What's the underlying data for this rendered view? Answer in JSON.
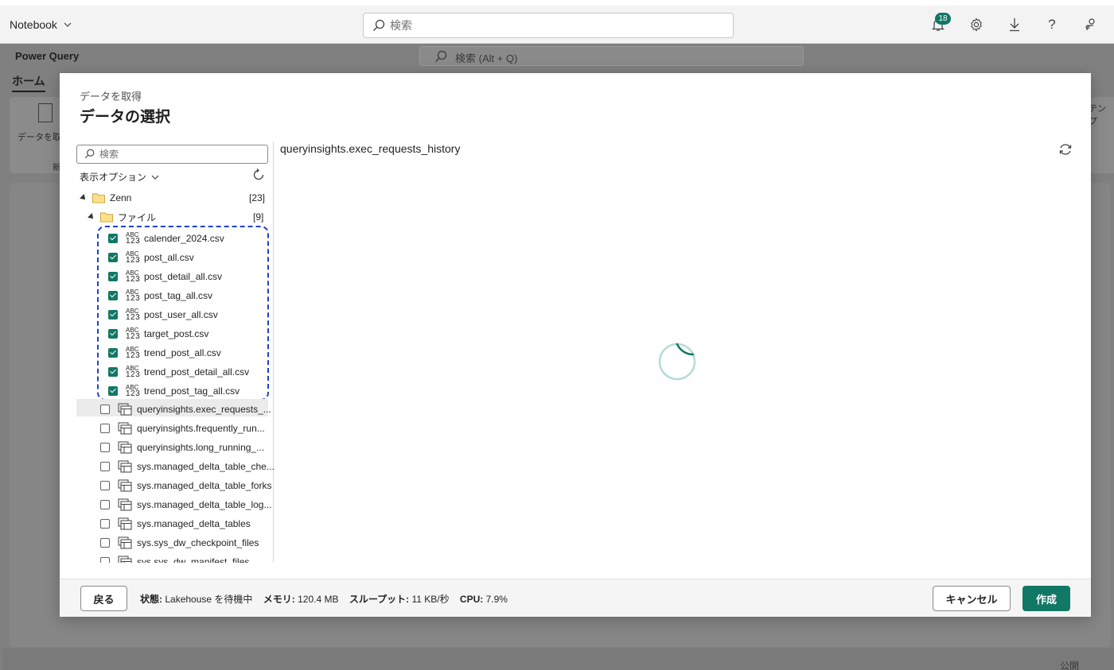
{
  "topbar": {
    "app_title": "Notebook",
    "search_placeholder": "検索",
    "notification_count": "18"
  },
  "background": {
    "pq_title": "Power Query",
    "pq_search_placeholder": "検索 (Alt + Q)",
    "home_tab": "ホーム",
    "ribbon_get_data": "データを取",
    "ribbon_group": "新",
    "right_label": "テンプ",
    "bottom_label": "公開"
  },
  "dialog": {
    "subtitle": "データを取得",
    "title": "データの選択",
    "nav_search_placeholder": "検索",
    "display_options": "表示オプション",
    "tree": {
      "root": {
        "label": "Zenn",
        "count": "[23]"
      },
      "folder": {
        "label": "ファイル",
        "count": "[9]"
      },
      "files": [
        {
          "type_top": "ABC",
          "type_bottom": "123",
          "label": "calender_2024.csv",
          "checked": true
        },
        {
          "type_top": "ABC",
          "type_bottom": "123",
          "label": "post_all.csv",
          "checked": true
        },
        {
          "type_top": "ABC",
          "type_bottom": "123",
          "label": "post_detail_all.csv",
          "checked": true
        },
        {
          "type_top": "ABC",
          "type_bottom": "123",
          "label": "post_tag_all.csv",
          "checked": true
        },
        {
          "type_top": "ABC",
          "type_bottom": "123",
          "label": "post_user_all.csv",
          "checked": true
        },
        {
          "type_top": "ABC",
          "type_bottom": "123",
          "label": "target_post.csv",
          "checked": true
        },
        {
          "type_top": "ABC",
          "type_bottom": "123",
          "label": "trend_post_all.csv",
          "checked": true
        },
        {
          "type_top": "ABC",
          "type_bottom": "123",
          "label": "trend_post_detail_all.csv",
          "checked": true
        },
        {
          "type_top": "ABC",
          "type_bottom": "123",
          "label": "trend_post_tag_all.csv",
          "checked": true
        }
      ],
      "tables": [
        {
          "label": "queryinsights.exec_requests_...",
          "checked": false,
          "selected": true
        },
        {
          "label": "queryinsights.frequently_run...",
          "checked": false
        },
        {
          "label": "queryinsights.long_running_...",
          "checked": false
        },
        {
          "label": "sys.managed_delta_table_che...",
          "checked": false
        },
        {
          "label": "sys.managed_delta_table_forks",
          "checked": false
        },
        {
          "label": "sys.managed_delta_table_log...",
          "checked": false
        },
        {
          "label": "sys.managed_delta_tables",
          "checked": false
        },
        {
          "label": "sys.sys_dw_checkpoint_files",
          "checked": false
        },
        {
          "label": "sys.sys_dw_manifest_files",
          "checked": false
        }
      ]
    },
    "preview_title": "queryinsights.exec_requests_history",
    "footer": {
      "back": "戻る",
      "status_label": "状態:",
      "status_value": "Lakehouse を待機中",
      "memory_label": "メモリ:",
      "memory_value": "120.4 MB",
      "throughput_label": "スループット:",
      "throughput_value": "11 KB/秒",
      "cpu_label": "CPU:",
      "cpu_value": "7.9%",
      "cancel": "キャンセル",
      "create": "作成"
    }
  },
  "colors": {
    "accent": "#117865",
    "highlight": "#1f3fd6"
  }
}
